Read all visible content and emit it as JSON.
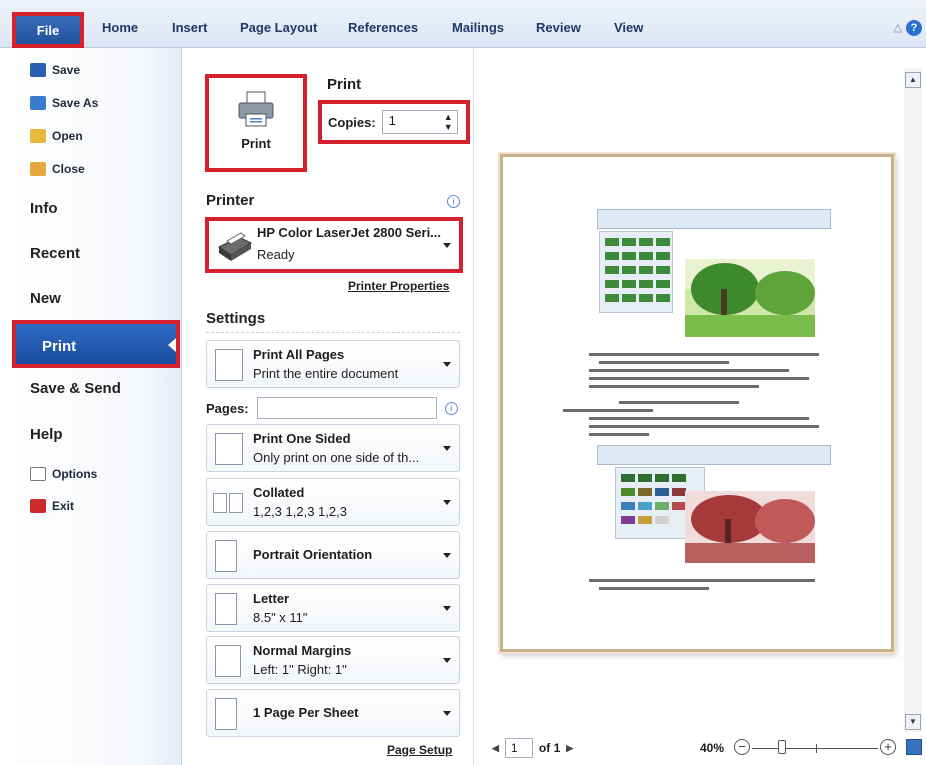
{
  "ribbon": {
    "file": "File",
    "tabs": [
      "Home",
      "Insert",
      "Page Layout",
      "References",
      "Mailings",
      "Review",
      "View"
    ],
    "help": "?"
  },
  "nav": {
    "save": "Save",
    "save_as": "Save As",
    "open": "Open",
    "close": "Close",
    "info": "Info",
    "recent": "Recent",
    "new": "New",
    "print": "Print",
    "save_send": "Save & Send",
    "help": "Help",
    "options": "Options",
    "exit": "Exit"
  },
  "print": {
    "button_label": "Print",
    "heading": "Print",
    "copies_label": "Copies:",
    "copies_value": "1"
  },
  "printer": {
    "heading": "Printer",
    "name": "HP Color LaserJet 2800 Seri...",
    "status": "Ready",
    "properties_link": "Printer Properties"
  },
  "settings": {
    "heading": "Settings",
    "print_range": {
      "title": "Print All Pages",
      "subtitle": "Print the entire document"
    },
    "pages_label": "Pages:",
    "sides": {
      "title": "Print One Sided",
      "subtitle": "Only print on one side of th..."
    },
    "collation": {
      "title": "Collated",
      "subtitle": "1,2,3   1,2,3   1,2,3"
    },
    "orientation": {
      "title": "Portrait Orientation"
    },
    "paper": {
      "title": "Letter",
      "subtitle": "8.5\" x 11\""
    },
    "margins": {
      "title": "Normal Margins",
      "subtitle": "Left: 1\"   Right: 1\""
    },
    "per_sheet": {
      "title": "1 Page Per Sheet"
    },
    "page_setup_link": "Page Setup"
  },
  "preview": {
    "current_page": "1",
    "of_pages": "of 1",
    "zoom": "40%"
  },
  "colors": {
    "highlight": "#d3222d",
    "accent": "#1f4f9b"
  }
}
